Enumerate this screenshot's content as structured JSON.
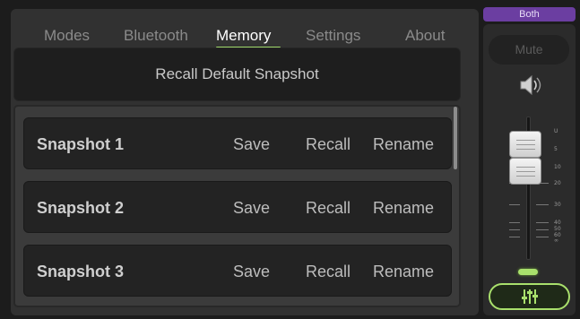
{
  "tabs": [
    {
      "label": "Modes",
      "active": false
    },
    {
      "label": "Bluetooth",
      "active": false
    },
    {
      "label": "Memory",
      "active": true
    },
    {
      "label": "Settings",
      "active": false
    },
    {
      "label": "About",
      "active": false
    }
  ],
  "recall_default_label": "Recall Default Snapshot",
  "snapshots": [
    {
      "name": "Snapshot 1",
      "save": "Save",
      "recall": "Recall",
      "rename": "Rename"
    },
    {
      "name": "Snapshot 2",
      "save": "Save",
      "recall": "Recall",
      "rename": "Rename"
    },
    {
      "name": "Snapshot 3",
      "save": "Save",
      "recall": "Recall",
      "rename": "Rename"
    }
  ],
  "channel": {
    "mode_tab": "Both",
    "mute_label": "Mute",
    "speaker_icon": "speaker-icon",
    "selector_icon": "sliders-icon",
    "fader_scale": [
      "U",
      "5",
      "10",
      "20",
      "30",
      "40",
      "50",
      "60",
      "∞"
    ]
  },
  "colors": {
    "accent_green": "#a9e06c",
    "mode_purple": "#6b3ea1",
    "panel_bg": "#313131"
  }
}
